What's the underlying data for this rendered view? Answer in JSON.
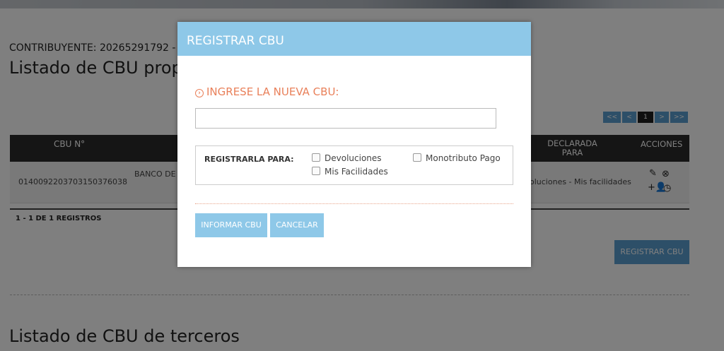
{
  "background": {
    "contribuyente": "CONTRIBUYENTE: 20265291792 - G",
    "title": "Listado de CBU propi",
    "pagination": {
      "first": "<<",
      "prev": "<",
      "current": "1",
      "next": ">",
      "last": ">>"
    },
    "table": {
      "headers": {
        "cbu": "CBU N°",
        "declarada": "DECLARADA PARA",
        "acciones": "ACCIONES"
      },
      "rows": [
        {
          "cbu": "0140092203703150376038",
          "banco": "BANCO DE",
          "declarada": "oluciones - Mis facilidades"
        }
      ]
    },
    "count": "1 - 1 DE 1 REGISTROS",
    "register_button": "REGISTRAR CBU",
    "section2_title": "Listado de CBU de terceros"
  },
  "modal": {
    "title": "REGISTRAR CBU",
    "subtitle": "INGRESE LA NUEVA CBU:",
    "input": {
      "value": "",
      "placeholder": ""
    },
    "register_for_label": "REGISTRARLA PARA:",
    "options": [
      {
        "label": "Devoluciones",
        "checked": false
      },
      {
        "label": "Monotributo Pago",
        "checked": false
      },
      {
        "label": "Mis Facilidades",
        "checked": false
      }
    ],
    "buttons": {
      "informar": "INFORMAR CBU",
      "cancelar": "CANCELAR"
    }
  },
  "colors": {
    "modal_accent": "#8ec8e8",
    "subtitle": "#e9805a",
    "primary": "#5b9fd1"
  }
}
